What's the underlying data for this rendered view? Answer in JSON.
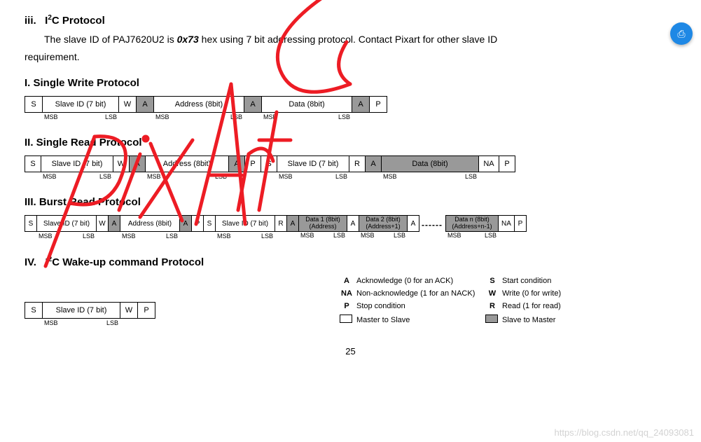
{
  "heading_iii": "iii.    I²C Protocol",
  "desc_line1": "The slave ID of PAJ7620U2 is ",
  "slave_id_hex": "0x73",
  "desc_line1_cont": " hex using 7 bit addressing protocol. Contact Pixart for other slave ID",
  "desc_line2": "requirement.",
  "sections": {
    "single_write": "I.     Single Write Protocol",
    "single_read": "II.    Single Read Protocol",
    "burst_read": "III.   Burst Read Protocol",
    "wakeup": "IV.   I²C Wake-up command Protocol"
  },
  "field": {
    "S": "S",
    "SlaveID7": "Slave ID (7 bit)",
    "W": "W",
    "A": "A",
    "Addr8": "Address (8bit)",
    "Data8": "Data (8bit)",
    "P": "P",
    "R": "R",
    "NA": "NA",
    "Data1": "Data 1 (8bit)",
    "Data1Addr": "(Address)",
    "Data2": "Data 2 (8bit)",
    "Data2Addr": "(Address+1)",
    "DataN": "Data n (8bit)",
    "DataNAddr": "(Address+n-1)",
    "MSB": "MSB",
    "LSB": "LSB",
    "dots": "------"
  },
  "legend": {
    "A": "Acknowledge (0 for an ACK)",
    "NA": "Non-acknowledge (1 for an NACK)",
    "P": "Stop condition",
    "MtoS": "Master to Slave",
    "S": "Start condition",
    "W": "Write (0 for write)",
    "R": "Read (1 for read)",
    "StoM": "Slave to Master"
  },
  "legend_sym": {
    "A": "A",
    "NA": "NA",
    "P": "P",
    "S": "S",
    "W": "W",
    "R": "R"
  },
  "pagenum": "25",
  "watermark_url": "https://blog.csdn.net/qq_24093081",
  "fab_glyph": "⎙"
}
